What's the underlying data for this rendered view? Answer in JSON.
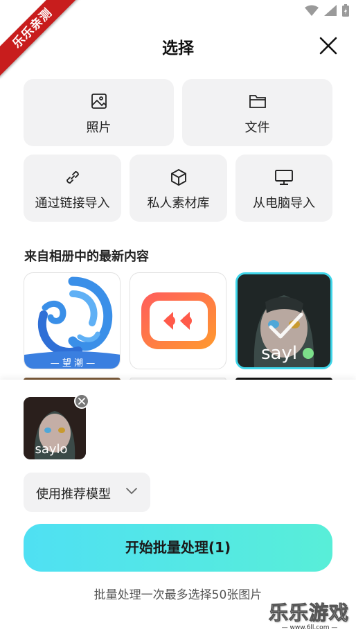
{
  "status_bar": {
    "icons": [
      "wifi-icon",
      "signal-icon",
      "battery-charging-icon"
    ]
  },
  "ribbon": {
    "text": "乐乐亲测"
  },
  "header": {
    "title": "选择",
    "close_icon": "close-icon"
  },
  "options": {
    "photo": {
      "label": "照片",
      "icon": "image-icon"
    },
    "file": {
      "label": "文件",
      "icon": "folder-icon"
    },
    "link_import": {
      "label": "通过链接导入",
      "icon": "link-icon"
    },
    "private_library": {
      "label": "私人素材库",
      "icon": "cube-icon"
    },
    "pc_import": {
      "label": "从电脑导入",
      "icon": "monitor-icon"
    }
  },
  "recent": {
    "title": "来自相册中的最新内容",
    "items": [
      {
        "name": "望潮",
        "icon": "app-logo-wangchao",
        "selected": false
      },
      {
        "name": "",
        "icon": "app-logo-red-chat",
        "selected": false
      },
      {
        "name": "saylo",
        "icon": "anime-portrait",
        "selected": true
      }
    ]
  },
  "bottom_sheet": {
    "selected_thumb_label": "saylo",
    "model_select": {
      "value": "使用推荐模型"
    },
    "start_button": {
      "label": "开始批量处理(1)"
    },
    "hint": "批量处理一次最多选择50张图片"
  },
  "watermark": {
    "text": "乐乐游戏",
    "sub": "— www.6ll.com —"
  },
  "colors": {
    "accent": "#4fe0f3",
    "accent_end": "#58eed8",
    "card_bg": "#f2f2f3",
    "ribbon": "#c81d1d"
  }
}
